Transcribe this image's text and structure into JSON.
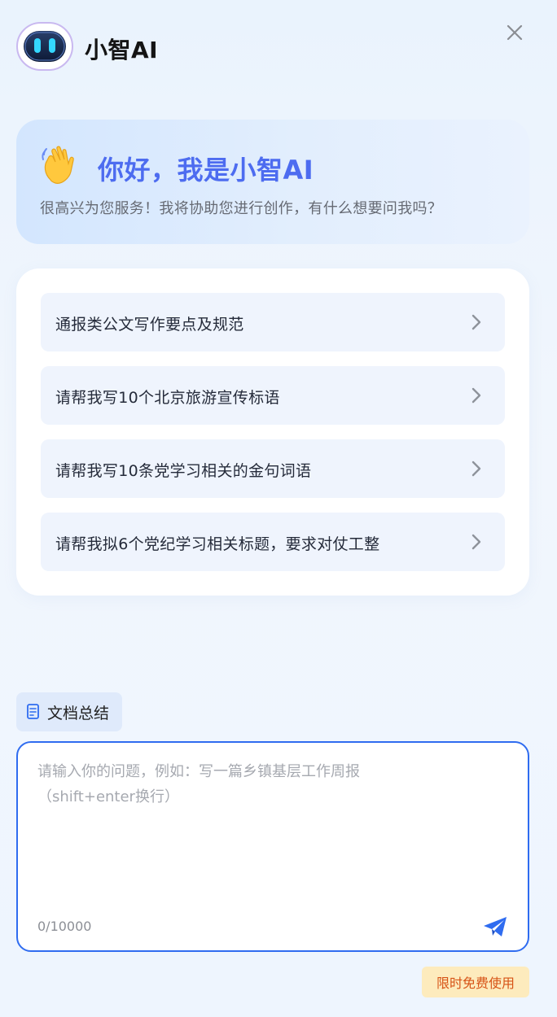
{
  "app": {
    "title": "小智AI",
    "avatar_icon": "robot-face-icon",
    "close_icon": "close-icon"
  },
  "welcome": {
    "emoji_icon": "waving-hand-icon",
    "title": "你好，我是小智AI",
    "subtitle": "很高兴为您服务！我将协助您进行创作，有什么想要问我吗？"
  },
  "suggestions": [
    {
      "label": "通报类公文写作要点及规范"
    },
    {
      "label": "请帮我写10个北京旅游宣传标语"
    },
    {
      "label": "请帮我写10条党学习相关的金句词语"
    },
    {
      "label": "请帮我拟6个党纪学习相关标题，要求对仗工整"
    }
  ],
  "tools": {
    "doc_summary_label": "文档总结",
    "doc_summary_icon": "document-icon"
  },
  "input": {
    "placeholder": "请输入你的问题，例如：写一篇乡镇基层工作周报\n（shift+enter换行）",
    "value": "",
    "counter": "0/10000",
    "send_icon": "send-icon"
  },
  "promo": {
    "label": "限时免费使用"
  },
  "colors": {
    "accent": "#2f6cf0",
    "greeting": "#4d6cf0",
    "promo_bg": "#fdebbd",
    "promo_text": "#d75316"
  }
}
